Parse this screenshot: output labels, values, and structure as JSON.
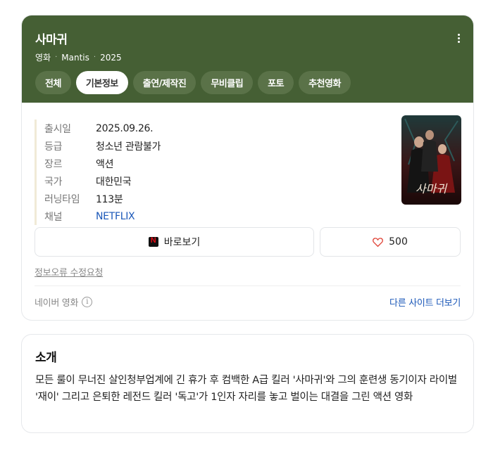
{
  "movie": {
    "title": "사마귀",
    "meta": [
      "영화",
      "Mantis",
      "2025"
    ]
  },
  "tabs": [
    {
      "label": "전체",
      "active": false
    },
    {
      "label": "기본정보",
      "active": true
    },
    {
      "label": "출연/제작진",
      "active": false
    },
    {
      "label": "무비클립",
      "active": false
    },
    {
      "label": "포토",
      "active": false
    },
    {
      "label": "추천영화",
      "active": false
    }
  ],
  "info": [
    {
      "key": "출시일",
      "value": "2025.09.26."
    },
    {
      "key": "등급",
      "value": "청소년 관람불가"
    },
    {
      "key": "장르",
      "value": "액션"
    },
    {
      "key": "국가",
      "value": "대한민국"
    },
    {
      "key": "러닝타임",
      "value": "113분"
    },
    {
      "key": "채널",
      "value": "NETFLIX"
    }
  ],
  "poster": {
    "title_text": "사마귀"
  },
  "actions": {
    "watch_label": "바로보기",
    "like_count": "500"
  },
  "report_label": "정보오류 수정요청",
  "footer": {
    "source": "네이버 영화",
    "more_label": "다른 사이트 더보기"
  },
  "intro": {
    "heading": "소개",
    "text": "모든 룰이 무너진 살인청부업계에 긴 휴가 후 컴백한 A급 킬러 '사마귀'와 그의 훈련생 동기이자 라이벌 '재이' 그리고 은퇴한 레전드 킬러 '독고'가 1인자 자리를 놓고 벌이는 대결을 그린 액션 영화"
  },
  "colors": {
    "header_bg": "#455f34",
    "link": "#1a57b8",
    "heart": "#e0463a"
  }
}
